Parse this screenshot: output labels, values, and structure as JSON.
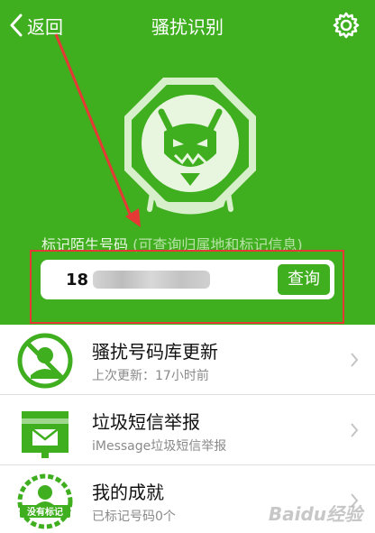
{
  "nav": {
    "back_label": "返回",
    "title": "骚扰识别"
  },
  "search": {
    "hint": "标记陌生号码",
    "hint_sub": "(可查询归属地和标记信息)",
    "value": "18",
    "button_label": "查询"
  },
  "list": [
    {
      "title": "骚扰号码库更新",
      "desc": "上次更新：17小时前",
      "icon": "no-call-icon"
    },
    {
      "title": "垃圾短信举报",
      "desc": "iMessage垃圾短信举报",
      "icon": "mailbox-icon"
    },
    {
      "title": "我的成就",
      "desc": "已标记号码0个",
      "icon": "achievement-badge-icon",
      "badge_text": "没有标记"
    }
  ],
  "watermark": "Baidu经验",
  "colors": {
    "brand": "#3fae1f",
    "annotation": "#e53935"
  }
}
